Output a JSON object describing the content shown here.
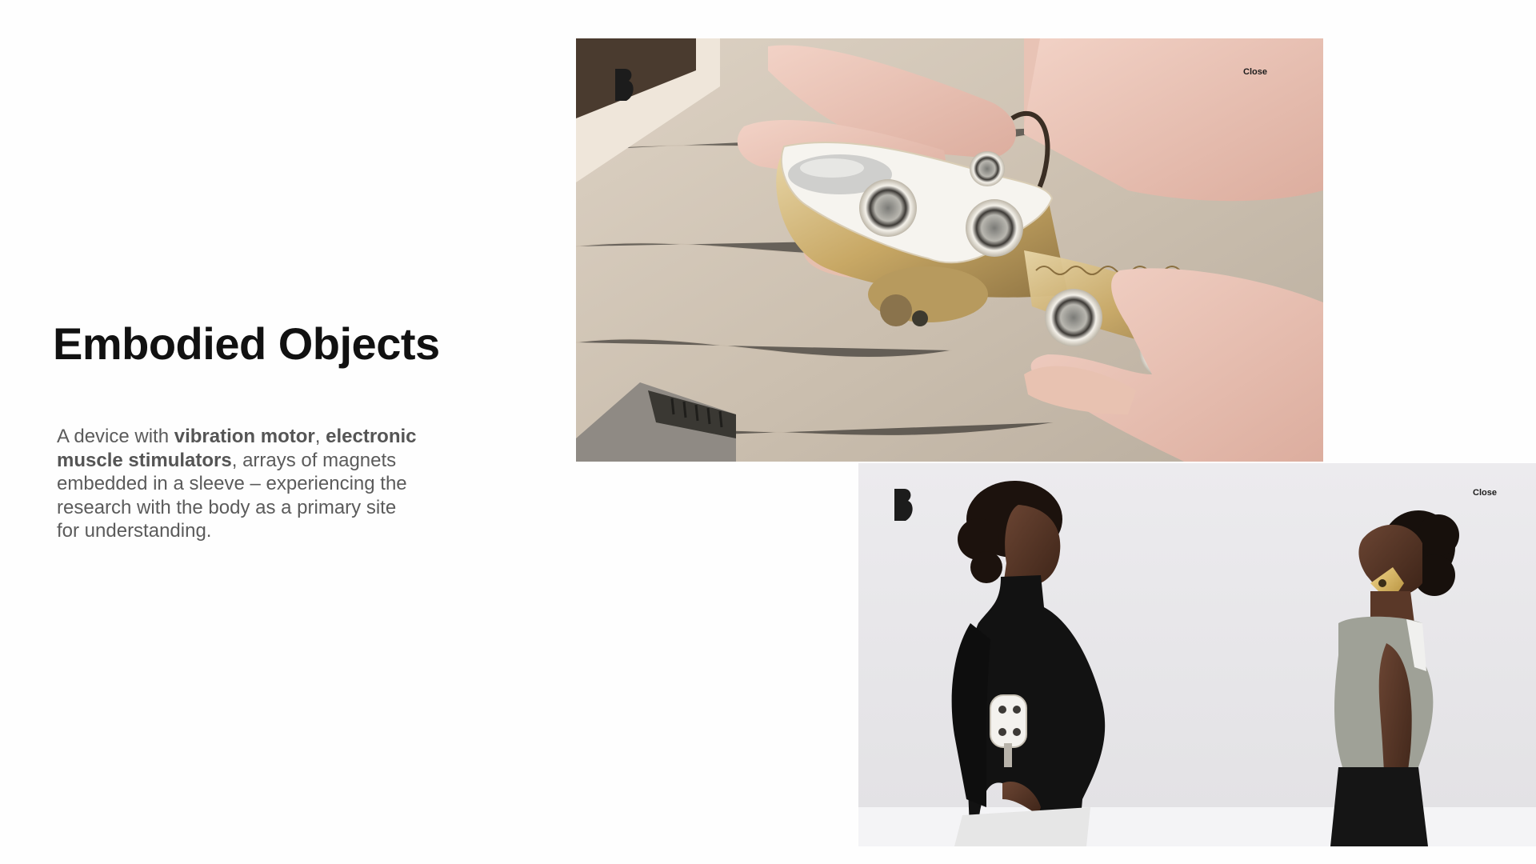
{
  "page": {
    "title": "Embodied Objects",
    "description": {
      "part1": "A device with ",
      "bold1": "vibration motor",
      "part2": ", ",
      "bold2": "electronic muscle stimulators",
      "part3": ", arrays of magnets embedded in a sleeve – experiencing the research with the body as a primary site for understanding."
    }
  },
  "media_top": {
    "close_label": "Close",
    "logo_icon": "brand-b-logo-icon",
    "alt": "Hands holding a white and brass haptic device with round magnets"
  },
  "media_bottom": {
    "close_label": "Close",
    "logo_icon": "brand-b-logo-icon",
    "alt": "Two women with eyes closed wearing haptic devices on arm and neck"
  },
  "colors": {
    "title": "#111111",
    "body_text": "#5b5b5b",
    "background": "#ffffff"
  }
}
